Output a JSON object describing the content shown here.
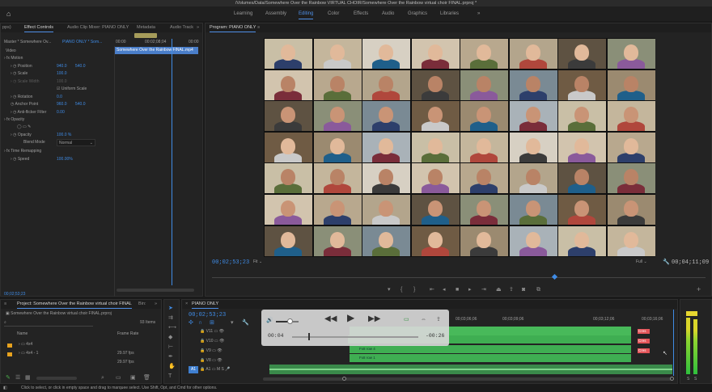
{
  "window": {
    "title": "/Volumes/Data/Somewhere Over the Rainbow VIRTUAL CHOIR/Somewhere Over the Rainbow virtual choir FINAL.prproj *"
  },
  "workspaces": [
    {
      "label": "Learning"
    },
    {
      "label": "Assembly"
    },
    {
      "label": "Editing"
    },
    {
      "label": "Color"
    },
    {
      "label": "Effects"
    },
    {
      "label": "Audio"
    },
    {
      "label": "Graphics"
    },
    {
      "label": "Libraries"
    }
  ],
  "workspace_more": "»",
  "effect_controls": {
    "tabs": [
      "pps)",
      "Effect Controls",
      "Audio Clip Mixer: PIANO ONLY",
      "Metadata",
      "Audio Track"
    ],
    "master_label": "Master * Somewhere Ov...",
    "sequence_label": "PIANO ONLY * Som...",
    "ruler_times": [
      "00:00",
      "00:02;08;04",
      "00:00"
    ],
    "clip_name": "Somewhere Over the Rainbow FINAL.mp4",
    "section_video": "Video",
    "motion": "Motion",
    "position_label": "Position",
    "position_x": "940.0",
    "position_y": "540.0",
    "scale_label": "Scale",
    "scale_value": "100.0",
    "scale_width_label": "Scale Width",
    "scale_width_value": "100.0",
    "uniform_scale": "Uniform Scale",
    "rotation_label": "Rotation",
    "rotation_value": "0.0",
    "anchor_label": "Anchor Point",
    "anchor_x": "960.0",
    "anchor_y": "540.0",
    "antiflicker_label": "Anti-flicker Filter",
    "antiflicker_value": "0.00",
    "opacity_section": "Opacity",
    "opacity_label": "Opacity",
    "opacity_value": "100.0 %",
    "blend_label": "Blend Mode",
    "blend_value": "Normal",
    "time_remap": "Time Remapping",
    "speed_label": "Speed",
    "speed_value": "100.00%",
    "bottom_timecode": "00;02;53;23"
  },
  "program": {
    "title": "Program: PIANO ONLY",
    "timecode": "00;02;53;23",
    "fit": "Fit",
    "quality": "Full",
    "duration": "00;04;11;09",
    "grid_rows": 7,
    "grid_cols": 8
  },
  "project": {
    "title": "Project: Somewhere Over the Rainbow virtual choir FINAL",
    "other_tab": "Bin:",
    "file_name": "Somewhere Over the Rainbow virtual choir FINAL.prproj",
    "item_count": "93 Items",
    "col_name": "Name",
    "col_rate": "Frame Rate",
    "items": [
      {
        "name": "4x4",
        "rate": ""
      },
      {
        "name": "4x4 - 1",
        "rate": "29.97 fps"
      },
      {
        "name": "",
        "rate": "29.97 fps"
      }
    ]
  },
  "timeline": {
    "title": "PIANO ONLY",
    "timecode": "00;02;53;23",
    "ruler": [
      "00;03;06;06",
      "00;03;09;06",
      "00;03;12;06",
      "00;03;16;06"
    ],
    "tracks": [
      "V11",
      "V10",
      "V9",
      "V8",
      "A1"
    ],
    "clips": [
      "Fx8 row 4",
      "Fx8 row 1"
    ],
    "red_labels": [
      "Cres",
      "Cres",
      "Cres"
    ]
  },
  "player_overlay": {
    "time_current": "00:04",
    "time_remaining": "-00:26",
    "progress": 0.13,
    "volume": 0.6
  },
  "status": {
    "text": "Click to select, or click in empty space and drag to marquee select. Use Shift, Opt, and Cmd for other options."
  },
  "meter_labels": [
    "S",
    "S"
  ],
  "colors": {
    "accent": "#3f8be5",
    "clip_green": "#3fae52",
    "clip_red": "#e4555a",
    "panel": "#232323"
  }
}
